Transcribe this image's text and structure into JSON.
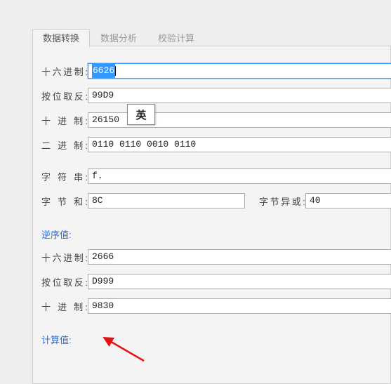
{
  "tabs": {
    "data_convert": "数据转换",
    "data_analysis": "数据分析",
    "check_calc": "校验计算"
  },
  "labels": {
    "hex": "十六进制:",
    "bitinvert": "按位取反:",
    "dec": "十 进 制:",
    "bin": "二 进 制:",
    "str": "字 符 串:",
    "bytesum": "字 节 和:",
    "bytexor": "字节异或:",
    "reverse_title": "逆序值:",
    "calc_title": "计算值:"
  },
  "values": {
    "hex": "6626",
    "bitinvert": "99D9",
    "dec": "26150",
    "bin": "0110 0110 0010 0110",
    "str": "f.",
    "bytesum": "8C",
    "bytexor": "40",
    "rev_hex": "2666",
    "rev_bitinvert": "D999",
    "rev_dec": "9830"
  },
  "ime": {
    "indicator": "英"
  }
}
